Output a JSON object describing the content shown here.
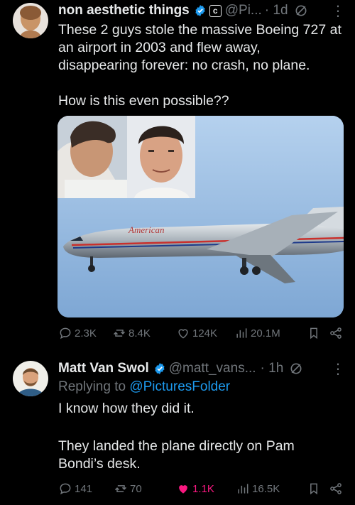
{
  "tweet1": {
    "display_name": "non aesthetic things",
    "badge_letter": "c",
    "handle": "@Pi...",
    "time": "· 1d",
    "text_line1": "These 2 guys stole the massive Boeing 727 at",
    "text_line2": "an airport in 2003 and flew away,",
    "text_line3": "disappearing forever: no crash, no plane.",
    "text_line4": "How is this even possible??",
    "media": {
      "livery_text": "American"
    },
    "stats": {
      "replies": "2.3K",
      "reposts": "8.4K",
      "likes": "124K",
      "views": "20.1M"
    }
  },
  "tweet2": {
    "display_name": "Matt Van Swol",
    "handle": "@matt_vans...",
    "time": "· 1h",
    "replying_prefix": "Replying to",
    "replying_to": "@PicturesFolder",
    "text_line1": "I know how they did it.",
    "text_line2": "They landed the plane directly on Pam",
    "text_line3": "Bondi’s desk.",
    "stats": {
      "replies": "141",
      "reposts": "70",
      "likes": "1.1K",
      "views": "16.5K"
    }
  },
  "colors": {
    "background": "#000000",
    "verified": "#1d9bf0",
    "link": "#1d9bf0",
    "like_active": "#f91880",
    "muted": "#71767b"
  }
}
